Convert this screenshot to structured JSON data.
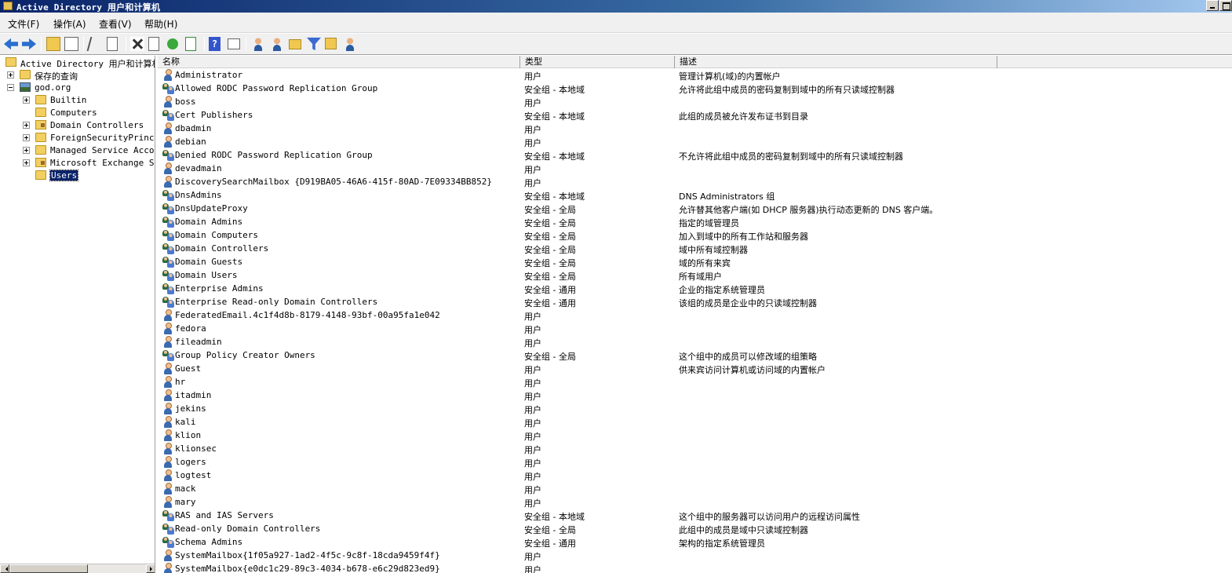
{
  "window": {
    "title": "Active Directory 用户和计算机"
  },
  "menu": [
    "文件(F)",
    "操作(A)",
    "查看(V)",
    "帮助(H)"
  ],
  "toolbar": [
    "back-icon",
    "forward-icon",
    "up-folder-icon",
    "show-tree-icon",
    "cut-icon",
    "copy-icon",
    "delete-icon",
    "properties-icon",
    "refresh-icon",
    "export-icon",
    "help-icon",
    "details-icon",
    "new-user-icon",
    "new-group-icon",
    "new-ou-icon",
    "filter-icon",
    "find-icon",
    "add-to-group-icon"
  ],
  "tree": [
    {
      "label": "Active Directory 用户和计算机",
      "level": 0,
      "icon": "ad",
      "expander": "none"
    },
    {
      "label": "保存的查询",
      "level": 1,
      "icon": "folder",
      "expander": "plus"
    },
    {
      "label": "god.org",
      "level": 1,
      "icon": "domain",
      "expander": "minus"
    },
    {
      "label": "Builtin",
      "level": 2,
      "icon": "folder",
      "expander": "plus"
    },
    {
      "label": "Computers",
      "level": 2,
      "icon": "folder",
      "expander": "none"
    },
    {
      "label": "Domain Controllers",
      "level": 2,
      "icon": "folder-ou",
      "expander": "plus"
    },
    {
      "label": "ForeignSecurityPrincip",
      "level": 2,
      "icon": "folder",
      "expander": "plus"
    },
    {
      "label": "Managed Service Accour",
      "level": 2,
      "icon": "folder",
      "expander": "plus"
    },
    {
      "label": "Microsoft Exchange Sec",
      "level": 2,
      "icon": "folder-ou",
      "expander": "plus"
    },
    {
      "label": "Users",
      "level": 2,
      "icon": "folder",
      "expander": "none",
      "selected": true
    }
  ],
  "columns": {
    "name": "名称",
    "type": "类型",
    "desc": "描述"
  },
  "rows": [
    {
      "icon": "user",
      "name": "Administrator",
      "type": "用户",
      "desc": "管理计算机(域)的内置帐户"
    },
    {
      "icon": "group",
      "name": "Allowed RODC Password Replication Group",
      "type": "安全组 - 本地域",
      "desc": "允许将此组中成员的密码复制到域中的所有只读域控制器"
    },
    {
      "icon": "user",
      "name": "boss",
      "type": "用户",
      "desc": ""
    },
    {
      "icon": "group",
      "name": "Cert Publishers",
      "type": "安全组 - 本地域",
      "desc": "此组的成员被允许发布证书到目录"
    },
    {
      "icon": "user",
      "name": "dbadmin",
      "type": "用户",
      "desc": ""
    },
    {
      "icon": "user",
      "name": "debian",
      "type": "用户",
      "desc": ""
    },
    {
      "icon": "group",
      "name": "Denied RODC Password Replication Group",
      "type": "安全组 - 本地域",
      "desc": "不允许将此组中成员的密码复制到域中的所有只读域控制器"
    },
    {
      "icon": "user",
      "name": "devadmain",
      "type": "用户",
      "desc": ""
    },
    {
      "icon": "user",
      "name": "DiscoverySearchMailbox {D919BA05-46A6-415f-80AD-7E09334BB852}",
      "type": "用户",
      "desc": ""
    },
    {
      "icon": "group",
      "name": "DnsAdmins",
      "type": "安全组 - 本地域",
      "desc": "DNS Administrators 组"
    },
    {
      "icon": "group",
      "name": "DnsUpdateProxy",
      "type": "安全组 - 全局",
      "desc": "允许替其他客户端(如 DHCP 服务器)执行动态更新的 DNS 客户端。"
    },
    {
      "icon": "group",
      "name": "Domain Admins",
      "type": "安全组 - 全局",
      "desc": "指定的域管理员"
    },
    {
      "icon": "group",
      "name": "Domain Computers",
      "type": "安全组 - 全局",
      "desc": "加入到域中的所有工作站和服务器"
    },
    {
      "icon": "group",
      "name": "Domain Controllers",
      "type": "安全组 - 全局",
      "desc": "域中所有域控制器"
    },
    {
      "icon": "group",
      "name": "Domain Guests",
      "type": "安全组 - 全局",
      "desc": "域的所有来宾"
    },
    {
      "icon": "group",
      "name": "Domain Users",
      "type": "安全组 - 全局",
      "desc": "所有域用户"
    },
    {
      "icon": "group",
      "name": "Enterprise Admins",
      "type": "安全组 - 通用",
      "desc": "企业的指定系统管理员"
    },
    {
      "icon": "group",
      "name": "Enterprise Read-only Domain Controllers",
      "type": "安全组 - 通用",
      "desc": "该组的成员是企业中的只读域控制器"
    },
    {
      "icon": "user",
      "name": "FederatedEmail.4c1f4d8b-8179-4148-93bf-00a95fa1e042",
      "type": "用户",
      "desc": ""
    },
    {
      "icon": "user",
      "name": "fedora",
      "type": "用户",
      "desc": ""
    },
    {
      "icon": "user",
      "name": "fileadmin",
      "type": "用户",
      "desc": ""
    },
    {
      "icon": "group",
      "name": "Group Policy Creator Owners",
      "type": "安全组 - 全局",
      "desc": "这个组中的成员可以修改域的组策略"
    },
    {
      "icon": "user",
      "name": "Guest",
      "type": "用户",
      "desc": "供来宾访问计算机或访问域的内置帐户"
    },
    {
      "icon": "user",
      "name": "hr",
      "type": "用户",
      "desc": ""
    },
    {
      "icon": "user",
      "name": "itadmin",
      "type": "用户",
      "desc": ""
    },
    {
      "icon": "user",
      "name": "jekins",
      "type": "用户",
      "desc": ""
    },
    {
      "icon": "user",
      "name": "kali",
      "type": "用户",
      "desc": ""
    },
    {
      "icon": "user",
      "name": "klion",
      "type": "用户",
      "desc": ""
    },
    {
      "icon": "user",
      "name": "klionsec",
      "type": "用户",
      "desc": ""
    },
    {
      "icon": "user",
      "name": "logers",
      "type": "用户",
      "desc": ""
    },
    {
      "icon": "user",
      "name": "logtest",
      "type": "用户",
      "desc": ""
    },
    {
      "icon": "user",
      "name": "mack",
      "type": "用户",
      "desc": ""
    },
    {
      "icon": "user",
      "name": "mary",
      "type": "用户",
      "desc": ""
    },
    {
      "icon": "group",
      "name": "RAS and IAS Servers",
      "type": "安全组 - 本地域",
      "desc": "这个组中的服务器可以访问用户的远程访问属性"
    },
    {
      "icon": "group",
      "name": "Read-only Domain Controllers",
      "type": "安全组 - 全局",
      "desc": "此组中的成员是域中只读域控制器"
    },
    {
      "icon": "group",
      "name": "Schema Admins",
      "type": "安全组 - 通用",
      "desc": "架构的指定系统管理员"
    },
    {
      "icon": "user",
      "name": "SystemMailbox{1f05a927-1ad2-4f5c-9c8f-18cda9459f4f}",
      "type": "用户",
      "desc": ""
    },
    {
      "icon": "user",
      "name": "SystemMailbox{e0dc1c29-89c3-4034-b678-e6c29d823ed9}",
      "type": "用户",
      "desc": ""
    }
  ]
}
